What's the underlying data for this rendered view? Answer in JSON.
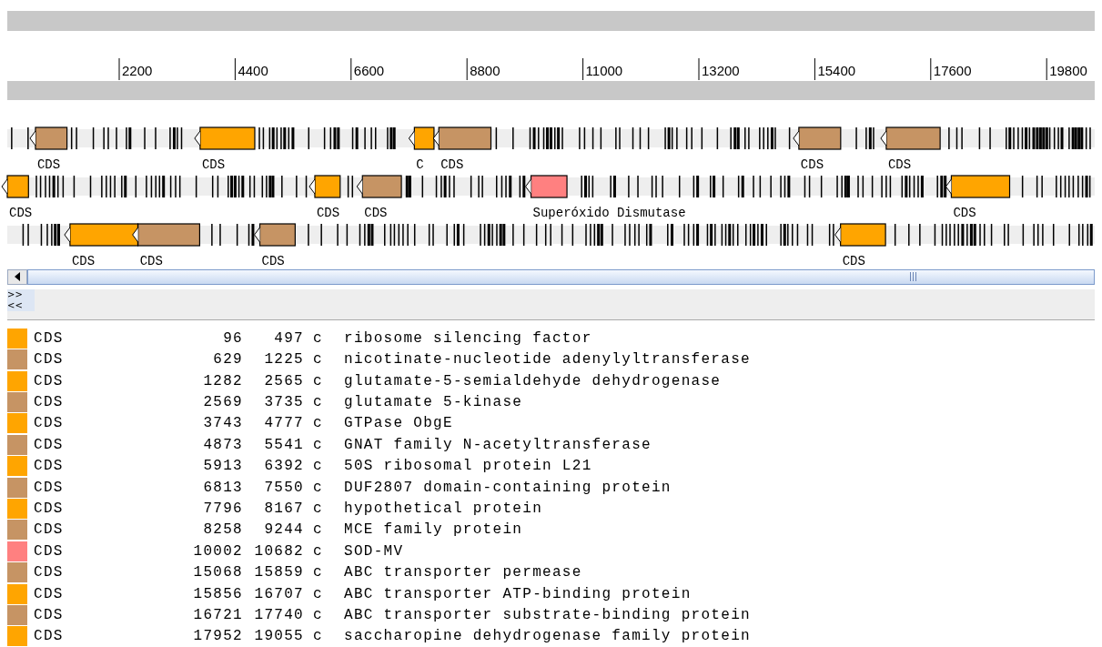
{
  "ruler": {
    "ticks": [
      "2200",
      "4400",
      "6600",
      "8800",
      "11000",
      "13200",
      "15400",
      "17600",
      "19800"
    ]
  },
  "scroll_buttons": [
    ">>",
    "<<"
  ],
  "features": [
    {
      "color": "#ffa500",
      "key": "CDS",
      "start": "96",
      "end": "497",
      "strand": "c",
      "product": "ribosome silencing factor",
      "kind": "middle",
      "track_label": "CDS"
    },
    {
      "color": "#c69464",
      "key": "CDS",
      "start": "629",
      "end": "1225",
      "strand": "c",
      "product": "nicotinate-nucleotide adenylyltransferase",
      "kind": "top",
      "track_label": "CDS"
    },
    {
      "color": "#ffa500",
      "key": "CDS",
      "start": "1282",
      "end": "2565",
      "strand": "c",
      "product": "glutamate-5-semialdehyde dehydrogenase",
      "kind": "bottom",
      "track_label": "CDS"
    },
    {
      "color": "#c69464",
      "key": "CDS",
      "start": "2569",
      "end": "3735",
      "strand": "c",
      "product": "glutamate 5-kinase",
      "kind": "bottom",
      "track_label": "CDS"
    },
    {
      "color": "#ffa500",
      "key": "CDS",
      "start": "3743",
      "end": "4777",
      "strand": "c",
      "product": "GTPase ObgE",
      "kind": "top",
      "track_label": "CDS"
    },
    {
      "color": "#c69464",
      "key": "CDS",
      "start": "4873",
      "end": "5541",
      "strand": "c",
      "product": "GNAT family N-acetyltransferase",
      "kind": "bottom",
      "track_label": "CDS"
    },
    {
      "color": "#ffa500",
      "key": "CDS",
      "start": "5913",
      "end": "6392",
      "strand": "c",
      "product": "50S ribosomal protein L21",
      "kind": "middle",
      "track_label": "CDS"
    },
    {
      "color": "#c69464",
      "key": "CDS",
      "start": "6813",
      "end": "7550",
      "strand": "c",
      "product": "DUF2807 domain-containing protein",
      "kind": "middle",
      "track_label": "CDS"
    },
    {
      "color": "#ffa500",
      "key": "CDS",
      "start": "7796",
      "end": "8167",
      "strand": "c",
      "product": "hypothetical protein",
      "kind": "top",
      "track_label": "C"
    },
    {
      "color": "#c69464",
      "key": "CDS",
      "start": "8258",
      "end": "9244",
      "strand": "c",
      "product": "MCE family protein",
      "kind": "top",
      "track_label": "CDS"
    },
    {
      "color": "#ff8080",
      "key": "CDS",
      "start": "10002",
      "end": "10682",
      "strand": "c",
      "product": "SOD-MV",
      "kind": "middle",
      "track_label": "Superóxido Dismutase"
    },
    {
      "color": "#c69464",
      "key": "CDS",
      "start": "15068",
      "end": "15859",
      "strand": "c",
      "product": "ABC transporter permease",
      "kind": "top",
      "track_label": "CDS"
    },
    {
      "color": "#ffa500",
      "key": "CDS",
      "start": "15856",
      "end": "16707",
      "strand": "c",
      "product": "ABC transporter ATP-binding protein",
      "kind": "bottom",
      "track_label": "CDS"
    },
    {
      "color": "#c69464",
      "key": "CDS",
      "start": "16721",
      "end": "17740",
      "strand": "c",
      "product": "ABC transporter substrate-binding protein",
      "kind": "top",
      "track_label": "CDS"
    },
    {
      "color": "#ffa500",
      "key": "CDS",
      "start": "17952",
      "end": "19055",
      "strand": "c",
      "product": "saccharopine dehydrogenase family protein",
      "kind": "middle",
      "track_label": "CDS"
    }
  ]
}
